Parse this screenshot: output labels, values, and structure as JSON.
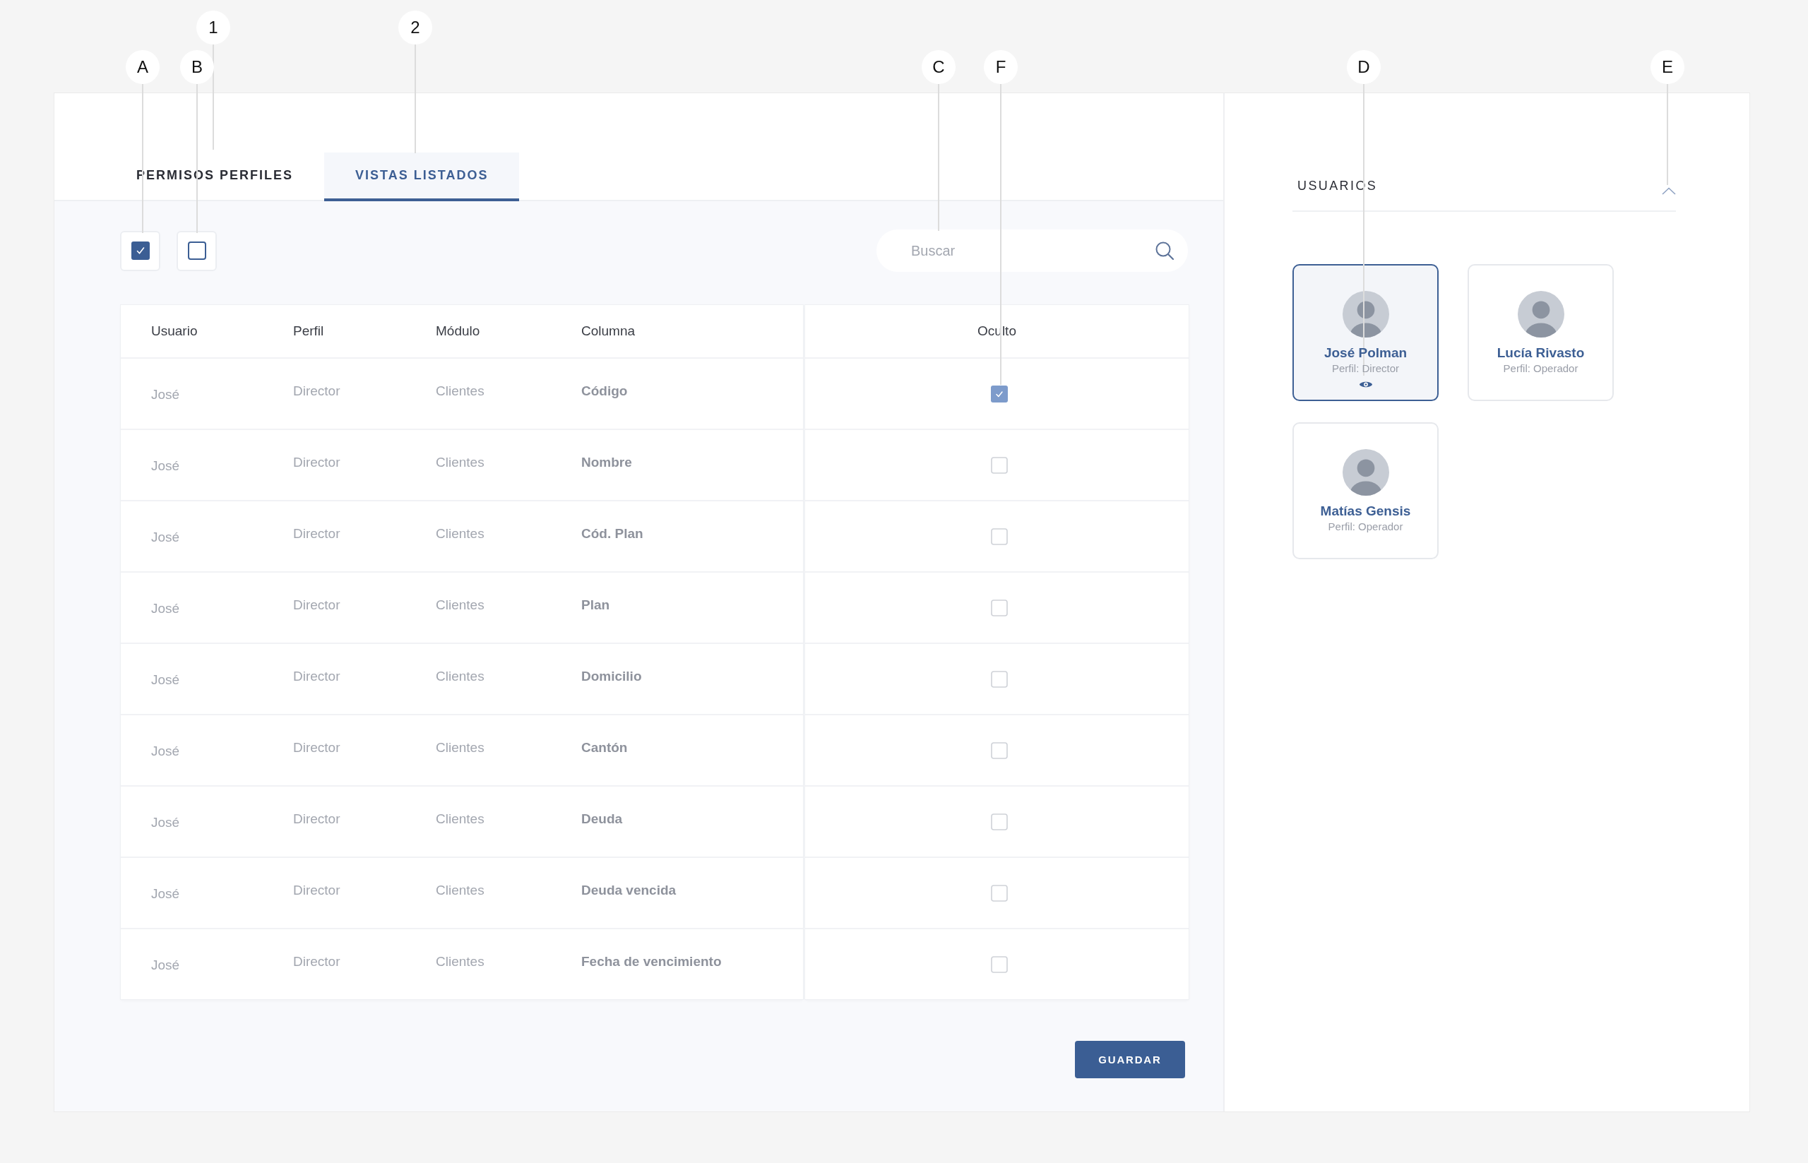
{
  "callouts": [
    {
      "label": "1"
    },
    {
      "label": "2"
    },
    {
      "label": "A"
    },
    {
      "label": "B"
    },
    {
      "label": "C"
    },
    {
      "label": "F"
    },
    {
      "label": "D"
    },
    {
      "label": "E"
    }
  ],
  "tabs": [
    {
      "label": "PERMISOS PERFILES",
      "selected": false
    },
    {
      "label": "VISTAS LISTADOS",
      "selected": true
    }
  ],
  "toggles": [
    {
      "checked": true
    },
    {
      "checked": false
    }
  ],
  "search": {
    "placeholder": "Buscar"
  },
  "table": {
    "columns": [
      "Usuario",
      "Perfil",
      "Módulo",
      "Columna"
    ],
    "hidden_column": "Oculto",
    "rows": [
      {
        "user": "José",
        "profile": "Director",
        "module": "Clientes",
        "column": "Código",
        "hidden": true
      },
      {
        "user": "José",
        "profile": "Director",
        "module": "Clientes",
        "column": "Nombre",
        "hidden": false
      },
      {
        "user": "José",
        "profile": "Director",
        "module": "Clientes",
        "column": "Cód. Plan",
        "hidden": false
      },
      {
        "user": "José",
        "profile": "Director",
        "module": "Clientes",
        "column": "Plan",
        "hidden": false
      },
      {
        "user": "José",
        "profile": "Director",
        "module": "Clientes",
        "column": "Domicilio",
        "hidden": false
      },
      {
        "user": "José",
        "profile": "Director",
        "module": "Clientes",
        "column": "Cantón",
        "hidden": false
      },
      {
        "user": "José",
        "profile": "Director",
        "module": "Clientes",
        "column": "Deuda",
        "hidden": false
      },
      {
        "user": "José",
        "profile": "Director",
        "module": "Clientes",
        "column": "Deuda vencida",
        "hidden": false
      },
      {
        "user": "José",
        "profile": "Director",
        "module": "Clientes",
        "column": "Fecha de vencimiento",
        "hidden": false
      }
    ]
  },
  "save_button": "GUARDAR",
  "users": {
    "title": "USUARIOS",
    "expanded": true,
    "items": [
      {
        "name": "José Polman",
        "profile": "Perfil: Director",
        "selected": true
      },
      {
        "name": "Lucía Rivasto",
        "profile": "Perfil: Operador",
        "selected": false
      },
      {
        "name": "Matías Gensis",
        "profile": "Perfil: Operador",
        "selected": false
      }
    ]
  }
}
